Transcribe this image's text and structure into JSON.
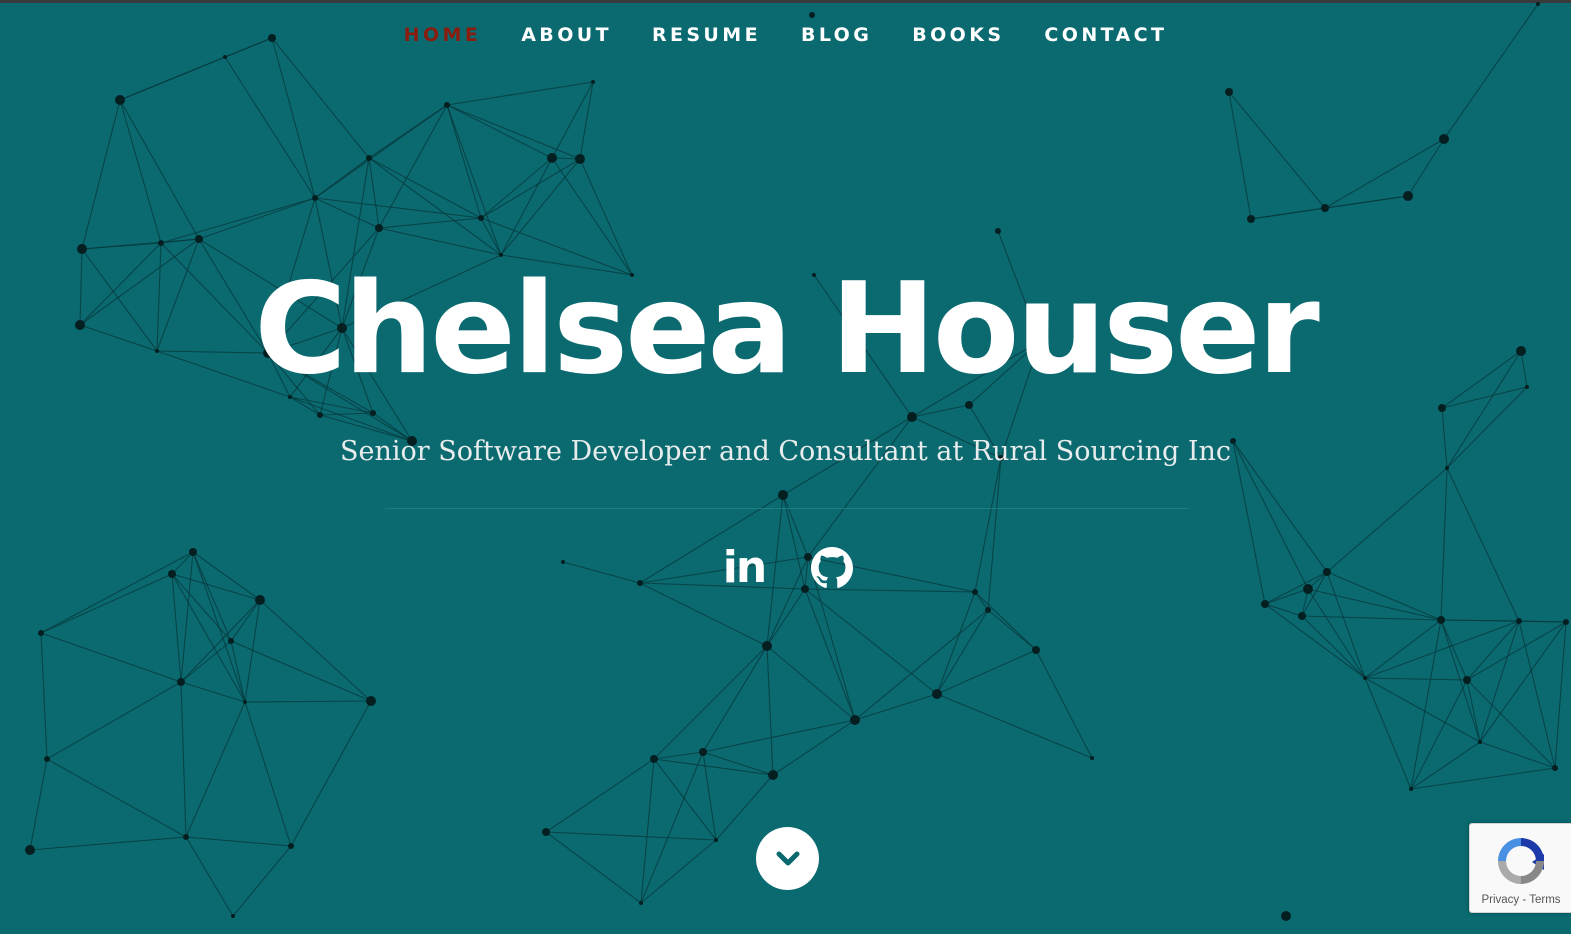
{
  "nav": {
    "items": [
      {
        "label": "HOME",
        "active": true
      },
      {
        "label": "ABOUT"
      },
      {
        "label": "RESUME"
      },
      {
        "label": "BLOG"
      },
      {
        "label": "BOOKS"
      },
      {
        "label": "CONTACT"
      }
    ]
  },
  "hero": {
    "name": "Chelsea Houser",
    "subtitle": "Senior Software Developer and Consultant at Rural Sourcing Inc"
  },
  "social": {
    "linkedin_icon": "linkedin-icon",
    "github_icon": "github-icon",
    "linkedin_label": "in"
  },
  "scroll": {
    "icon": "chevron-down-icon"
  },
  "recaptcha": {
    "privacy": "Privacy",
    "separator": "-",
    "terms": "Terms"
  },
  "colors": {
    "background": "#0a6a70",
    "active_nav": "#8b1d0f",
    "network": "#051f21"
  }
}
